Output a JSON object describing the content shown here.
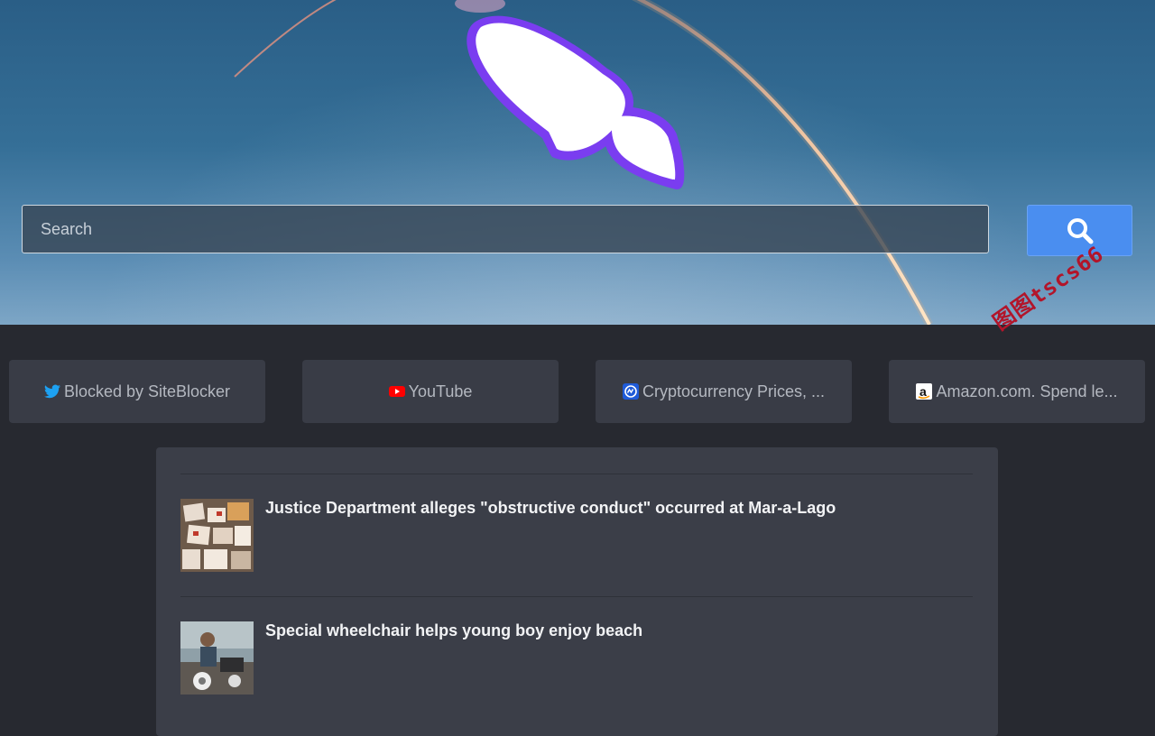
{
  "search": {
    "placeholder": "Search"
  },
  "shortcuts": [
    {
      "label": "Blocked by SiteBlocker",
      "icon": "twitter-icon"
    },
    {
      "label": "YouTube",
      "icon": "youtube-icon"
    },
    {
      "label": "Cryptocurrency Prices, ...",
      "icon": "coinmarketcap-icon"
    },
    {
      "label": "Amazon.com. Spend le...",
      "icon": "amazon-icon"
    }
  ],
  "news": [
    {
      "title": "Justice Department alleges \"obstructive conduct\" occurred at Mar-a-Lago"
    },
    {
      "title": "Special wheelchair helps young boy enjoy beach"
    }
  ],
  "watermark": "图图tscs66",
  "colors": {
    "accent": "#4a8ef0",
    "logo_outline": "#7a3df0",
    "background": "#272930"
  }
}
